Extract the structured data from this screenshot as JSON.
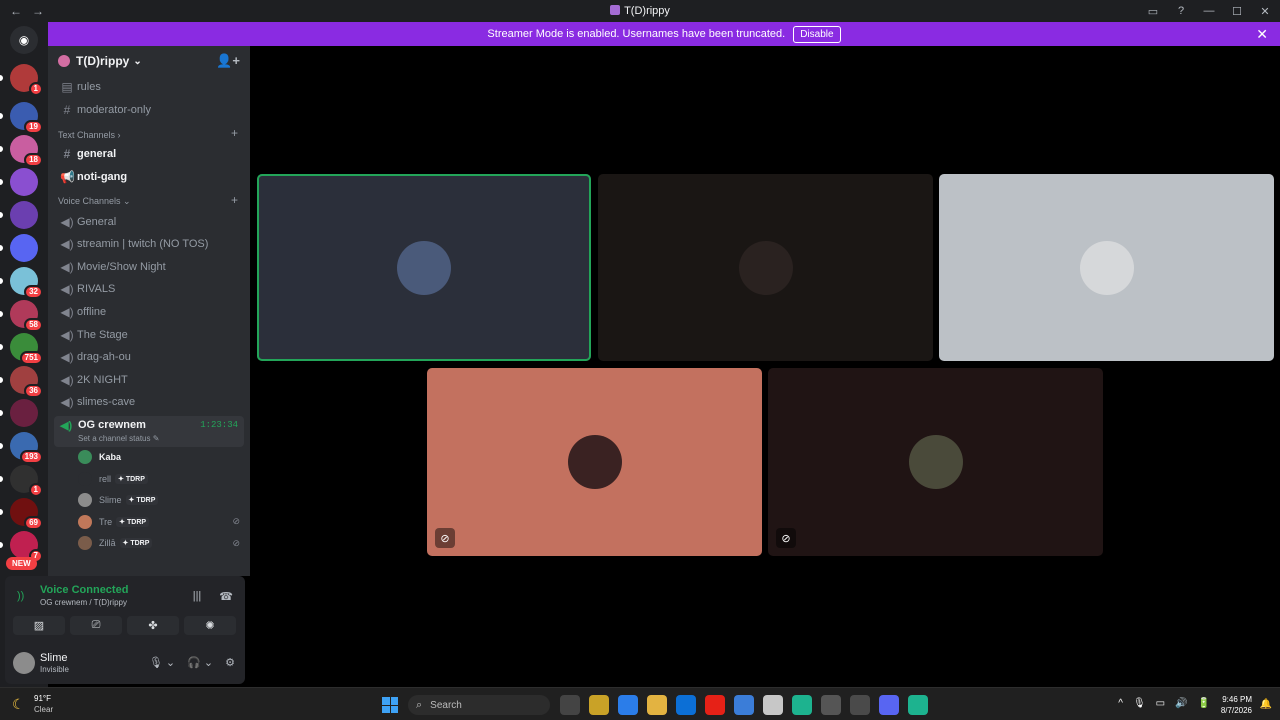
{
  "window": {
    "title": "T(D)rippy",
    "back": "←",
    "forward": "→",
    "controls": [
      "▭",
      "?",
      "—",
      "☐",
      "✕"
    ]
  },
  "banner": {
    "text": "Streamer Mode is enabled. Usernames have been truncated.",
    "button": "Disable",
    "close": "✕"
  },
  "guild": {
    "name": "T(D)rippy",
    "chevron": "⌄",
    "invite_icon": "👤+"
  },
  "channels_top": [
    {
      "name": "rules",
      "icon": "rules-icon",
      "sym": "▤"
    },
    {
      "name": "moderator-only",
      "icon": "hash-icon",
      "sym": "#"
    }
  ],
  "text_category": {
    "label": "Text Channels ›",
    "plus": "+"
  },
  "text_channels": [
    {
      "name": "general",
      "icon": "hash-icon",
      "sym": "#"
    },
    {
      "name": "noti-gang",
      "icon": "announcement-icon",
      "sym": "📢"
    }
  ],
  "voice_category": {
    "label": "Voice Channels ⌄",
    "plus": "+"
  },
  "voice_channels": [
    {
      "name": "General"
    },
    {
      "name": "streamin | twitch (NO TOS)"
    },
    {
      "name": "Movie/Show Night"
    },
    {
      "name": "RIVALS"
    },
    {
      "name": "offline"
    },
    {
      "name": "The Stage"
    },
    {
      "name": "drag-ah-ou"
    },
    {
      "name": "2K NIGHT"
    },
    {
      "name": "slimes-cave"
    }
  ],
  "active_voice": {
    "name": "OG crewnem",
    "timer": "1:23:34",
    "status": "Set a channel status ✎",
    "members": [
      {
        "name": "Kaba",
        "tag": "",
        "color": "#3a8c5a",
        "muted": "",
        "bright": true
      },
      {
        "name": "rell",
        "tag": "✦ TDRP",
        "color": "#2b2d31",
        "muted": ""
      },
      {
        "name": "Slime",
        "tag": "✦ TDRP",
        "color": "#8c8c8c",
        "muted": ""
      },
      {
        "name": "Tre",
        "tag": "✦ TDRP",
        "color": "#c0785a",
        "muted": "⊘"
      },
      {
        "name": "Zillā",
        "tag": "✦ TDRP",
        "color": "#7a5c4a",
        "muted": "⊘"
      }
    ]
  },
  "voice_panel": {
    "status": "Voice Connected",
    "sub": "OG crewnem / T(D)rippy",
    "buttons": [
      "▨",
      "⎚",
      "✤",
      "✺"
    ]
  },
  "user_panel": {
    "name": "Slime",
    "status": "Invisible",
    "mic": "🎙 ⌄",
    "headset": "🎧 ⌄",
    "settings": "⚙"
  },
  "servers": [
    {
      "badge": "1",
      "color": "#b03a3a"
    },
    {
      "badge": "19",
      "color": "#3a5cb0"
    },
    {
      "badge": "18",
      "color": "#c95ea0"
    },
    {
      "badge": "",
      "color": "#8a4fd0"
    },
    {
      "badge": "",
      "color": "#6b3fb0"
    },
    {
      "badge": "",
      "color": "#5865f2"
    },
    {
      "badge": "32",
      "color": "#7ac1d8"
    },
    {
      "badge": "58",
      "color": "#b03a5a"
    },
    {
      "badge": "751",
      "color": "#3a8c3a"
    },
    {
      "badge": "36",
      "color": "#a04040"
    },
    {
      "badge": "",
      "color": "#6a2040"
    },
    {
      "badge": "193",
      "color": "#3a6ab0"
    },
    {
      "badge": "1",
      "color": "#303030"
    },
    {
      "badge": "69",
      "color": "#701010"
    },
    {
      "badge": "7",
      "color": "#c02050"
    }
  ],
  "new_badge": "NEW",
  "video_tiles": [
    {
      "bg": "#2b2f3a",
      "avatar": "#4a5a7a",
      "speaking": true,
      "muted": ""
    },
    {
      "bg": "#1a1614",
      "avatar": "#2a2220",
      "speaking": false,
      "muted": ""
    },
    {
      "bg": "#bcc1c6",
      "avatar": "#d6d8da",
      "speaking": false,
      "muted": ""
    },
    {
      "bg": "#c3715f",
      "avatar": "#3a2222",
      "speaking": false,
      "muted": "⊘"
    },
    {
      "bg": "#201414",
      "avatar": "#4a4a3a",
      "speaking": false,
      "muted": "⊘"
    }
  ],
  "taskbar": {
    "weather_temp": "91°F",
    "weather_cond": "Clear",
    "search": "Search",
    "time": "9:46 PM",
    "date": "8/7/2026",
    "tray": [
      "^",
      "🎙",
      "▭",
      "🔊",
      "🔋"
    ],
    "apps": [
      "#444",
      "#c9a227",
      "#2b7de9",
      "#e3b341",
      "#0c6fd6",
      "#e62117",
      "#3b7dd8",
      "#c7c7c7",
      "#1db38f",
      "#555",
      "#4a4a4a",
      "#5865f2",
      "#1db38f"
    ]
  }
}
